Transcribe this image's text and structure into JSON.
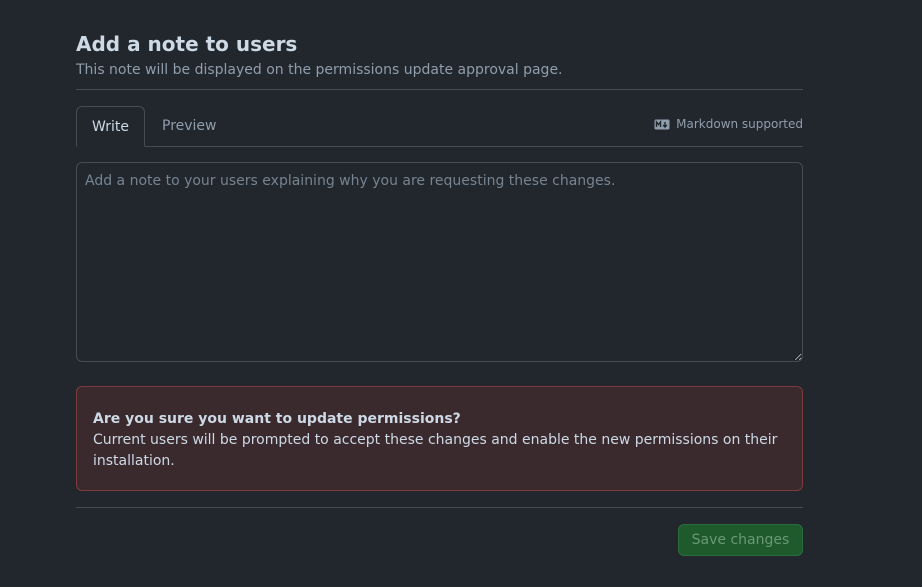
{
  "section": {
    "title": "Add a note to users",
    "subtitle": "This note will be displayed on the permissions update approval page."
  },
  "tabs": {
    "write_label": "Write",
    "preview_label": "Preview",
    "active": "Write"
  },
  "markdown": {
    "label": "Markdown supported",
    "icon": "markdown-icon"
  },
  "note": {
    "value": "",
    "placeholder": "Add a note to your users explaining why you are requesting these changes."
  },
  "warning": {
    "title": "Are you sure you want to update permissions?",
    "text": "Current users will be prompted to accept these changes and enable the new permissions on their installation."
  },
  "actions": {
    "save_label": "Save changes"
  },
  "colors": {
    "background": "#22272e",
    "border": "#444c56",
    "danger_bg": "#3a2a2e",
    "danger_border": "#7d3b3b",
    "success_bg": "#1e5a2c"
  }
}
